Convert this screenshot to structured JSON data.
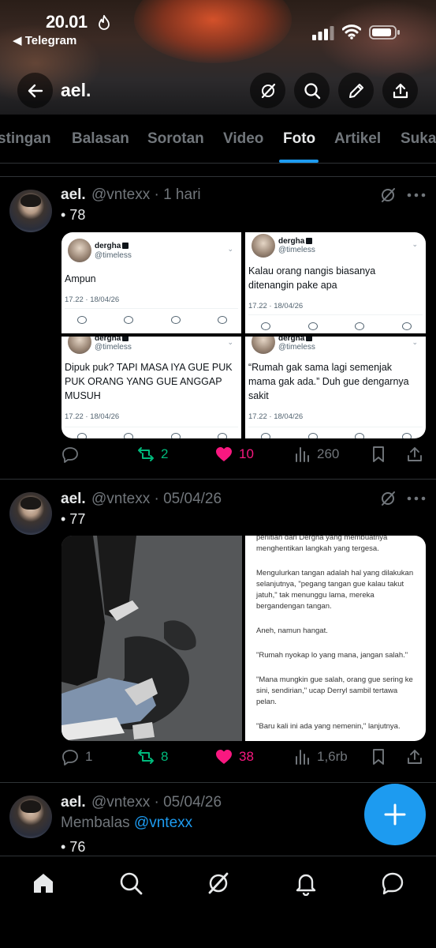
{
  "status_bar": {
    "time": "20.01",
    "back_app": "Telegram"
  },
  "header": {
    "title": "ael."
  },
  "tabs": [
    "stingan",
    "Balasan",
    "Sorotan",
    "Video",
    "Foto",
    "Artikel",
    "Suka"
  ],
  "active_tab": "Foto",
  "posts": [
    {
      "name": "ael.",
      "handle": "@vntexx · 1 hari",
      "text": "• 78",
      "quoted": [
        {
          "name": "dergha",
          "handle": "@timeless",
          "text": "Ampun",
          "meta": "17.22 · 18/04/26"
        },
        {
          "name": "dergha",
          "handle": "@timeless",
          "text": "Kalau orang nangis biasanya ditenangin pake apa",
          "meta": "17.22 · 18/04/26"
        },
        {
          "name": "dergha",
          "handle": "@timeless",
          "text": "Dipuk puk? TAPI MASA IYA GUE PUK PUK ORANG YANG GUE ANGGAP MUSUH",
          "meta": "17.22 · 18/04/26"
        },
        {
          "name": "dergha",
          "handle": "@timeless",
          "text": "“Rumah gak sama lagi semenjak mama gak ada.” Duh gue dengarnya sakit",
          "meta": "17.22 · 18/04/26"
        }
      ],
      "actions": {
        "replies": "",
        "reposts": "2",
        "likes": "10",
        "views": "260"
      }
    },
    {
      "name": "ael.",
      "handle": "@vntexx · 05/04/26",
      "text": "• 77",
      "story": [
        "perlitian dari Dergha yang membuatnya menghentikan langkah yang tergesa.",
        "Mengulurkan tangan adalah hal yang dilakukan selanjutnya, \"pegang tangan gue kalau takut jatuh,\" tak menunggu lama, mereka bergandengan tangan.",
        "Aneh, namun hangat.",
        "\"Rumah nyokap lo yang mana, jangan salah.\"",
        "\"Mana mungkin gue salah, orang gue sering ke sini, sendirian,\" ucap Derryl sambil tertawa pelan.",
        "\"Baru kali ini ada yang nemenin,\" lanjutnya."
      ],
      "actions": {
        "replies": "1",
        "reposts": "8",
        "likes": "38",
        "views": "1,6rb"
      }
    },
    {
      "name": "ael.",
      "handle": "@vntexx · 05/04/26",
      "reply_prefix": "Membalas",
      "reply_to": "@vntexx",
      "text": "• 76"
    }
  ],
  "colors": {
    "accent": "#1d9bf0",
    "repost": "#00ba7c",
    "like": "#f91880",
    "muted": "#71767b"
  },
  "nav_icons": [
    "home-icon",
    "search-icon",
    "grok-icon",
    "bell-icon",
    "messages-icon"
  ]
}
